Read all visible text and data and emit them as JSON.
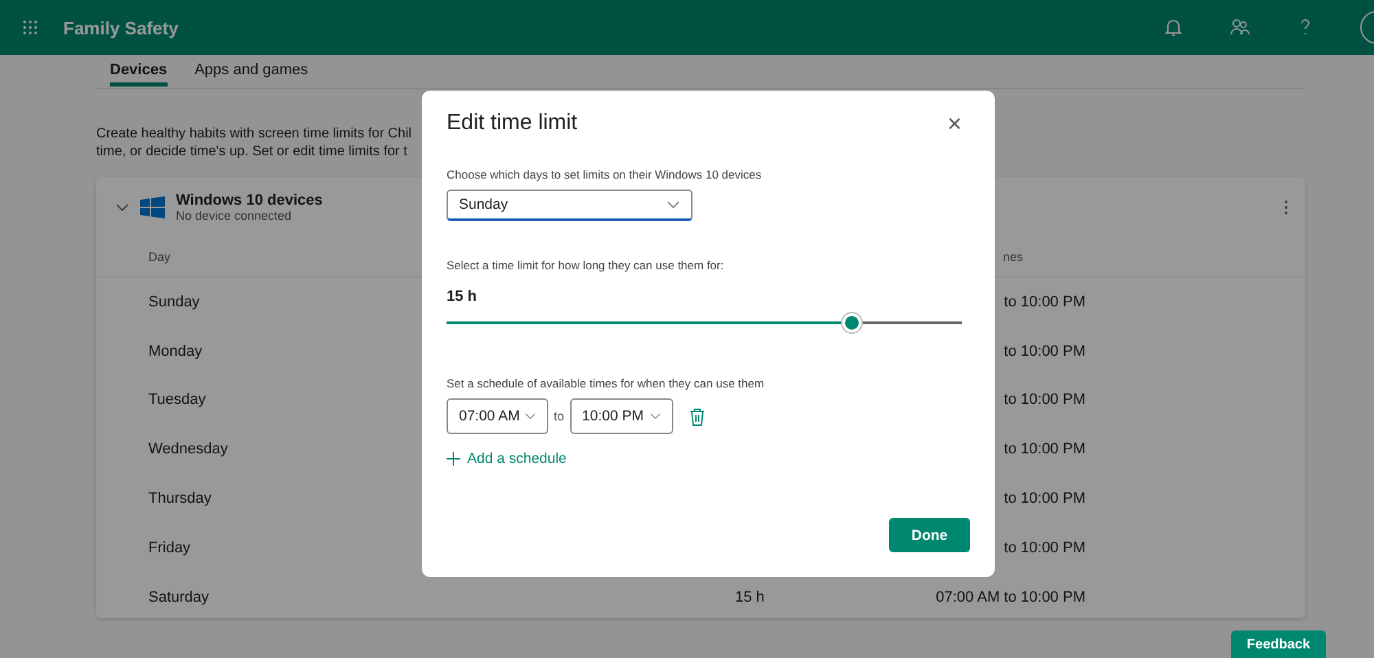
{
  "header": {
    "title": "Family Safety"
  },
  "tabs": [
    {
      "label": "Devices",
      "selected": true
    },
    {
      "label": "Apps and games",
      "selected": false
    }
  ],
  "intro": [
    "Create healthy habits with screen time limits for Chil",
    "time, or decide time's up. Set or edit time limits for t"
  ],
  "device_card": {
    "title": "Windows 10 devices",
    "subtitle": "No device connected",
    "expanded": true,
    "columns": [
      "Day",
      "nes"
    ],
    "rows": [
      {
        "day": "Sunday",
        "schedule": "to 10:00 PM"
      },
      {
        "day": "Monday",
        "schedule": "to 10:00 PM"
      },
      {
        "day": "Tuesday",
        "schedule": "to 10:00 PM"
      },
      {
        "day": "Wednesday",
        "schedule": "to 10:00 PM"
      },
      {
        "day": "Thursday",
        "schedule": "to 10:00 PM"
      },
      {
        "day": "Friday",
        "schedule": "to 10:00 PM"
      },
      {
        "day": "Saturday",
        "limit": "15 h",
        "schedule": "07:00 AM to 10:00 PM"
      }
    ]
  },
  "dialog": {
    "title": "Edit time limit",
    "close": "×",
    "days_label": "Choose which days to set limits on their Windows 10 devices",
    "days_value": "Sunday",
    "limit_label": "Select a time limit for how long they can use them for:",
    "limit_value": "15 h",
    "level": 0.787,
    "schedule_label": "Set a schedule of available times for when they can use them",
    "schedule_from": "07:00 AM",
    "schedule_sep": "to",
    "schedule_to": "10:00 PM",
    "add_schedule": "Add a schedule",
    "done": "Done"
  },
  "feedback": "Feedback"
}
